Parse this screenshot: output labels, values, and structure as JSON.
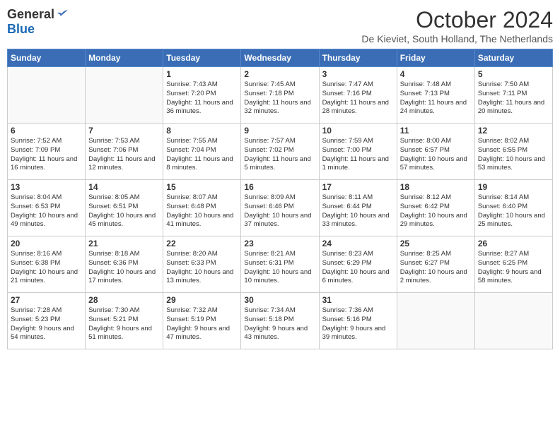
{
  "logo": {
    "general": "General",
    "blue": "Blue"
  },
  "title": "October 2024",
  "location": "De Kieviet, South Holland, The Netherlands",
  "days_of_week": [
    "Sunday",
    "Monday",
    "Tuesday",
    "Wednesday",
    "Thursday",
    "Friday",
    "Saturday"
  ],
  "weeks": [
    [
      {
        "day": "",
        "data": ""
      },
      {
        "day": "",
        "data": ""
      },
      {
        "day": "1",
        "data": "Sunrise: 7:43 AM\nSunset: 7:20 PM\nDaylight: 11 hours and 36 minutes."
      },
      {
        "day": "2",
        "data": "Sunrise: 7:45 AM\nSunset: 7:18 PM\nDaylight: 11 hours and 32 minutes."
      },
      {
        "day": "3",
        "data": "Sunrise: 7:47 AM\nSunset: 7:16 PM\nDaylight: 11 hours and 28 minutes."
      },
      {
        "day": "4",
        "data": "Sunrise: 7:48 AM\nSunset: 7:13 PM\nDaylight: 11 hours and 24 minutes."
      },
      {
        "day": "5",
        "data": "Sunrise: 7:50 AM\nSunset: 7:11 PM\nDaylight: 11 hours and 20 minutes."
      }
    ],
    [
      {
        "day": "6",
        "data": "Sunrise: 7:52 AM\nSunset: 7:09 PM\nDaylight: 11 hours and 16 minutes."
      },
      {
        "day": "7",
        "data": "Sunrise: 7:53 AM\nSunset: 7:06 PM\nDaylight: 11 hours and 12 minutes."
      },
      {
        "day": "8",
        "data": "Sunrise: 7:55 AM\nSunset: 7:04 PM\nDaylight: 11 hours and 8 minutes."
      },
      {
        "day": "9",
        "data": "Sunrise: 7:57 AM\nSunset: 7:02 PM\nDaylight: 11 hours and 5 minutes."
      },
      {
        "day": "10",
        "data": "Sunrise: 7:59 AM\nSunset: 7:00 PM\nDaylight: 11 hours and 1 minute."
      },
      {
        "day": "11",
        "data": "Sunrise: 8:00 AM\nSunset: 6:57 PM\nDaylight: 10 hours and 57 minutes."
      },
      {
        "day": "12",
        "data": "Sunrise: 8:02 AM\nSunset: 6:55 PM\nDaylight: 10 hours and 53 minutes."
      }
    ],
    [
      {
        "day": "13",
        "data": "Sunrise: 8:04 AM\nSunset: 6:53 PM\nDaylight: 10 hours and 49 minutes."
      },
      {
        "day": "14",
        "data": "Sunrise: 8:05 AM\nSunset: 6:51 PM\nDaylight: 10 hours and 45 minutes."
      },
      {
        "day": "15",
        "data": "Sunrise: 8:07 AM\nSunset: 6:48 PM\nDaylight: 10 hours and 41 minutes."
      },
      {
        "day": "16",
        "data": "Sunrise: 8:09 AM\nSunset: 6:46 PM\nDaylight: 10 hours and 37 minutes."
      },
      {
        "day": "17",
        "data": "Sunrise: 8:11 AM\nSunset: 6:44 PM\nDaylight: 10 hours and 33 minutes."
      },
      {
        "day": "18",
        "data": "Sunrise: 8:12 AM\nSunset: 6:42 PM\nDaylight: 10 hours and 29 minutes."
      },
      {
        "day": "19",
        "data": "Sunrise: 8:14 AM\nSunset: 6:40 PM\nDaylight: 10 hours and 25 minutes."
      }
    ],
    [
      {
        "day": "20",
        "data": "Sunrise: 8:16 AM\nSunset: 6:38 PM\nDaylight: 10 hours and 21 minutes."
      },
      {
        "day": "21",
        "data": "Sunrise: 8:18 AM\nSunset: 6:36 PM\nDaylight: 10 hours and 17 minutes."
      },
      {
        "day": "22",
        "data": "Sunrise: 8:20 AM\nSunset: 6:33 PM\nDaylight: 10 hours and 13 minutes."
      },
      {
        "day": "23",
        "data": "Sunrise: 8:21 AM\nSunset: 6:31 PM\nDaylight: 10 hours and 10 minutes."
      },
      {
        "day": "24",
        "data": "Sunrise: 8:23 AM\nSunset: 6:29 PM\nDaylight: 10 hours and 6 minutes."
      },
      {
        "day": "25",
        "data": "Sunrise: 8:25 AM\nSunset: 6:27 PM\nDaylight: 10 hours and 2 minutes."
      },
      {
        "day": "26",
        "data": "Sunrise: 8:27 AM\nSunset: 6:25 PM\nDaylight: 9 hours and 58 minutes."
      }
    ],
    [
      {
        "day": "27",
        "data": "Sunrise: 7:28 AM\nSunset: 5:23 PM\nDaylight: 9 hours and 54 minutes."
      },
      {
        "day": "28",
        "data": "Sunrise: 7:30 AM\nSunset: 5:21 PM\nDaylight: 9 hours and 51 minutes."
      },
      {
        "day": "29",
        "data": "Sunrise: 7:32 AM\nSunset: 5:19 PM\nDaylight: 9 hours and 47 minutes."
      },
      {
        "day": "30",
        "data": "Sunrise: 7:34 AM\nSunset: 5:18 PM\nDaylight: 9 hours and 43 minutes."
      },
      {
        "day": "31",
        "data": "Sunrise: 7:36 AM\nSunset: 5:16 PM\nDaylight: 9 hours and 39 minutes."
      },
      {
        "day": "",
        "data": ""
      },
      {
        "day": "",
        "data": ""
      }
    ]
  ]
}
